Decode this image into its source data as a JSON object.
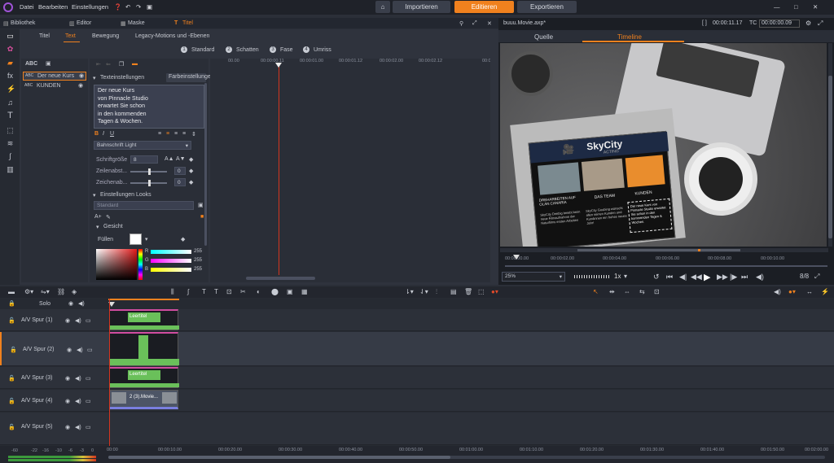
{
  "menu": {
    "items": [
      "Datei",
      "Bearbeiten",
      "Einstellungen"
    ]
  },
  "topbar": {
    "import": "Importieren",
    "edit": "Editieren",
    "export": "Exportieren"
  },
  "libbar": {
    "library": "Bibliothek",
    "editor": "Editor",
    "mask": "Maske",
    "title": "Titel"
  },
  "titlepanel": {
    "tabs": [
      "Titel",
      "Text",
      "Bewegung",
      "Legacy-Motions und -Ebenen"
    ],
    "styles": [
      {
        "n": "1",
        "label": "Standard"
      },
      {
        "n": "2",
        "label": "Schatten"
      },
      {
        "n": "3",
        "label": "Fase"
      },
      {
        "n": "4",
        "label": "Umriss"
      }
    ],
    "layers": [
      "Der neue Kurs",
      "KUNDEN"
    ],
    "text_settings": "Texteinstellungen",
    "color_settings": "Farbeinstellungen",
    "text_lines": [
      "Der neue Kurs",
      "von Pinnacle Studio",
      "erwartet Sie schon",
      "in den kommenden",
      "Tagen & Wochen."
    ],
    "font": "Bahnschrift Light",
    "fontsize_label": "Schriftgröße",
    "fontsize": "8",
    "line_spacing_label": "Zeilenabst...",
    "char_spacing_label": "Zeichenab...",
    "spacing_value": "0",
    "looks_label": "Einstellungen Looks",
    "looks_value": "Standard",
    "face_label": "Gesicht",
    "fill_label": "Füllen",
    "rgb": [
      {
        "k": "R",
        "v": "255"
      },
      {
        "k": "G",
        "v": "255"
      },
      {
        "k": "B",
        "v": "255"
      }
    ],
    "ruler": [
      "00.00",
      "00:00:00.11",
      "00:00:01.00",
      "00:00:01.12",
      "00:00:02.00",
      "00:00:02.12",
      "00:00"
    ]
  },
  "preview": {
    "filename": "buuu.Movie.axp*",
    "timecode1": "00:00:11.17",
    "timecode_label": "TC",
    "timecode2": "00:00:00.09",
    "tabs": [
      "Quelle",
      "Timeline"
    ],
    "zoom": "25%",
    "speed": "1x",
    "ruler": [
      "00:00:00.00",
      "00:00:02.00",
      "00:00:04.00",
      "00:00:06.00",
      "00:00:08.00",
      "00:00:10.00"
    ],
    "flyer": {
      "brand": "SkyCity",
      "sub": "ACTING",
      "captions": [
        "DREHARBEITEN AUF OLAN CANARIA",
        "DAS TEAM",
        "KUNDEN"
      ],
      "col1": "SkyCity Dreibig beiebt beim neue Filmaufnahme der Naturfilms ersten Arbeiten",
      "col2": "SkyCity Goubing wünscht allen seinen Kunden und Kundinnen ein frohes neues Jahr!",
      "col3": "Der neue Kurs von Pinnacle Studio erwartet Sie schon in den kommenden Tagen & Wochen."
    }
  },
  "timeline": {
    "solo": "Solo",
    "tracks": [
      {
        "name": "A/V Spur (1)",
        "clip": "Leertitel"
      },
      {
        "name": "A/V Spur (2)",
        "clip": ""
      },
      {
        "name": "A/V Spur (3)",
        "clip": "Leertitel"
      },
      {
        "name": "A/V Spur (4)",
        "clip": "2 (3).Movie..."
      },
      {
        "name": "A/V Spur (5)",
        "clip": ""
      }
    ],
    "ruler": [
      "00:00",
      "00:00:10.00",
      "00:00:20.00",
      "00:00:30.00",
      "00:00:40.00",
      "00:00:50.00",
      "00:01:00.00",
      "00:01:10.00",
      "00:01:20.00",
      "00:01:30.00",
      "00:01:40.00",
      "00:01:50.00",
      "00:02:00.00"
    ],
    "meter": [
      "-60",
      "-22",
      "-16",
      "-10",
      "-6",
      "-3",
      "0"
    ]
  },
  "colors": {
    "accent": "#f0811e",
    "bg": "#2b2f38",
    "active_tab": "#e07a18"
  }
}
